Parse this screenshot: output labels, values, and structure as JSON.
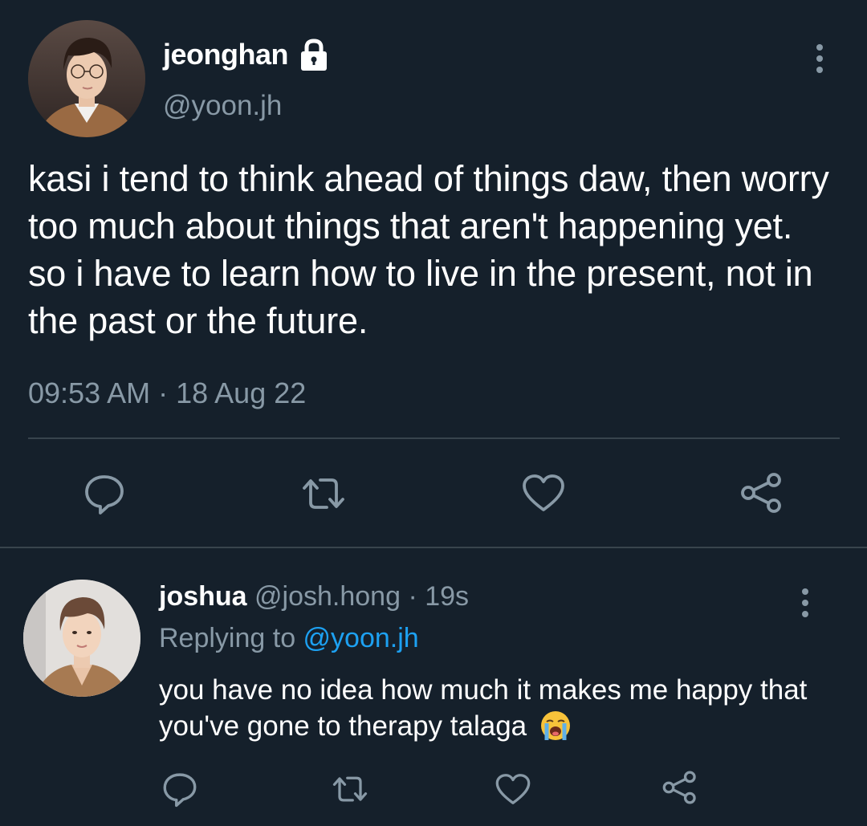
{
  "main_tweet": {
    "display_name": "jeonghan",
    "handle": "@yoon.jh",
    "text": "kasi i tend to think ahead of things daw, then worry too much about things that aren't happening yet. so i have to learn how to live in the present, not in the past or the future.",
    "timestamp": "09:53 AM · 18 Aug 22",
    "icons": {
      "verified_status": "lock-icon",
      "more": "more-vertical-icon",
      "actions": [
        "reply-icon",
        "retweet-icon",
        "like-icon",
        "share-icon"
      ]
    }
  },
  "reply_tweet": {
    "display_name": "joshua",
    "handle": "@josh.hong",
    "separator": " · ",
    "age": "19s",
    "replying_prefix": "Replying to ",
    "replying_to": "@yoon.jh",
    "text": "you have no idea how much it makes me happy that you've gone to therapy talaga",
    "emoji": "loudly-crying-face",
    "icons": {
      "more": "more-vertical-icon",
      "actions": [
        "reply-icon",
        "retweet-icon",
        "like-icon",
        "share-icon"
      ]
    }
  },
  "colors": {
    "background": "#15202b",
    "primary_text": "#ffffff",
    "secondary_text": "#8899a6",
    "link": "#1da1f2",
    "divider": "#38444d"
  }
}
